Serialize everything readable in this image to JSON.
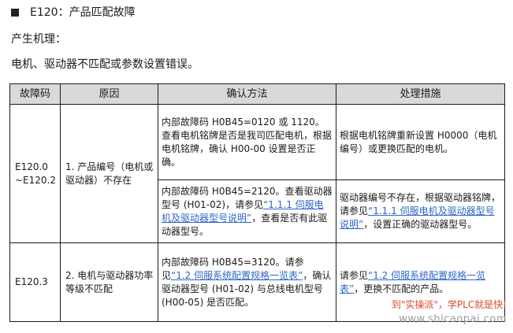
{
  "heading": "E120：产品匹配故障",
  "mechanism_label": "产生机理：",
  "mechanism_text": "电机、驱动器不匹配或参数设置错误。",
  "table": {
    "headers": [
      "故障码",
      "原因",
      "确认方法",
      "处理措施"
    ],
    "row1": {
      "code": "E120.0 ~E120.2",
      "cause": "1. 产品编号（电机或驱动器）不存在",
      "sub1": {
        "method": "内部故障码 H0B45=0120 或 1120。查看电机铭牌是否是我司匹配电机，根据电机铭牌，确认 H00-00 设置是否正确。",
        "action": "根据电机铭牌重新设置 H0000（电机编号）或更换匹配的电机。"
      },
      "sub2": {
        "method_pre": "内部故障码 H0B45=2120。查看驱动器型号 (H01-02)，请参见",
        "method_link": "“1.1.1 伺服电机及驱动器型号说明”",
        "method_post": "，查看是否有此驱动器型号。",
        "action_pre": "驱动器编号不存在，根据驱动器铭牌，请参见",
        "action_link": "“1.1.1 伺服电机及驱动器型号说明”",
        "action_post": "，设置正确的驱动器型号。"
      }
    },
    "row2": {
      "code": "E120.3",
      "cause": "2. 电机与驱动器功率等级不匹配",
      "method_pre": "内部故障码 H0B45=3120。请参见",
      "method_link": "“1.2 伺服系统配置规格一览表”",
      "method_post": "，确认驱动器型号 (H01-02) 与总线电机型号 (H00-05) 是否匹配。",
      "action_pre": "请参见",
      "action_link": "“1.2 伺服系统配置规格一览表”",
      "action_post": "，更换不匹配的产品。"
    }
  },
  "watermark": {
    "line1": "到\"实操派\"，学PLC就是快!",
    "line2": "www.shicaopai.com"
  },
  "colors": {
    "link": "#2e67c7",
    "header_bg": "#d9d9d9",
    "watermark_red": "#d8482d",
    "watermark_gray": "#9b9b9b"
  }
}
